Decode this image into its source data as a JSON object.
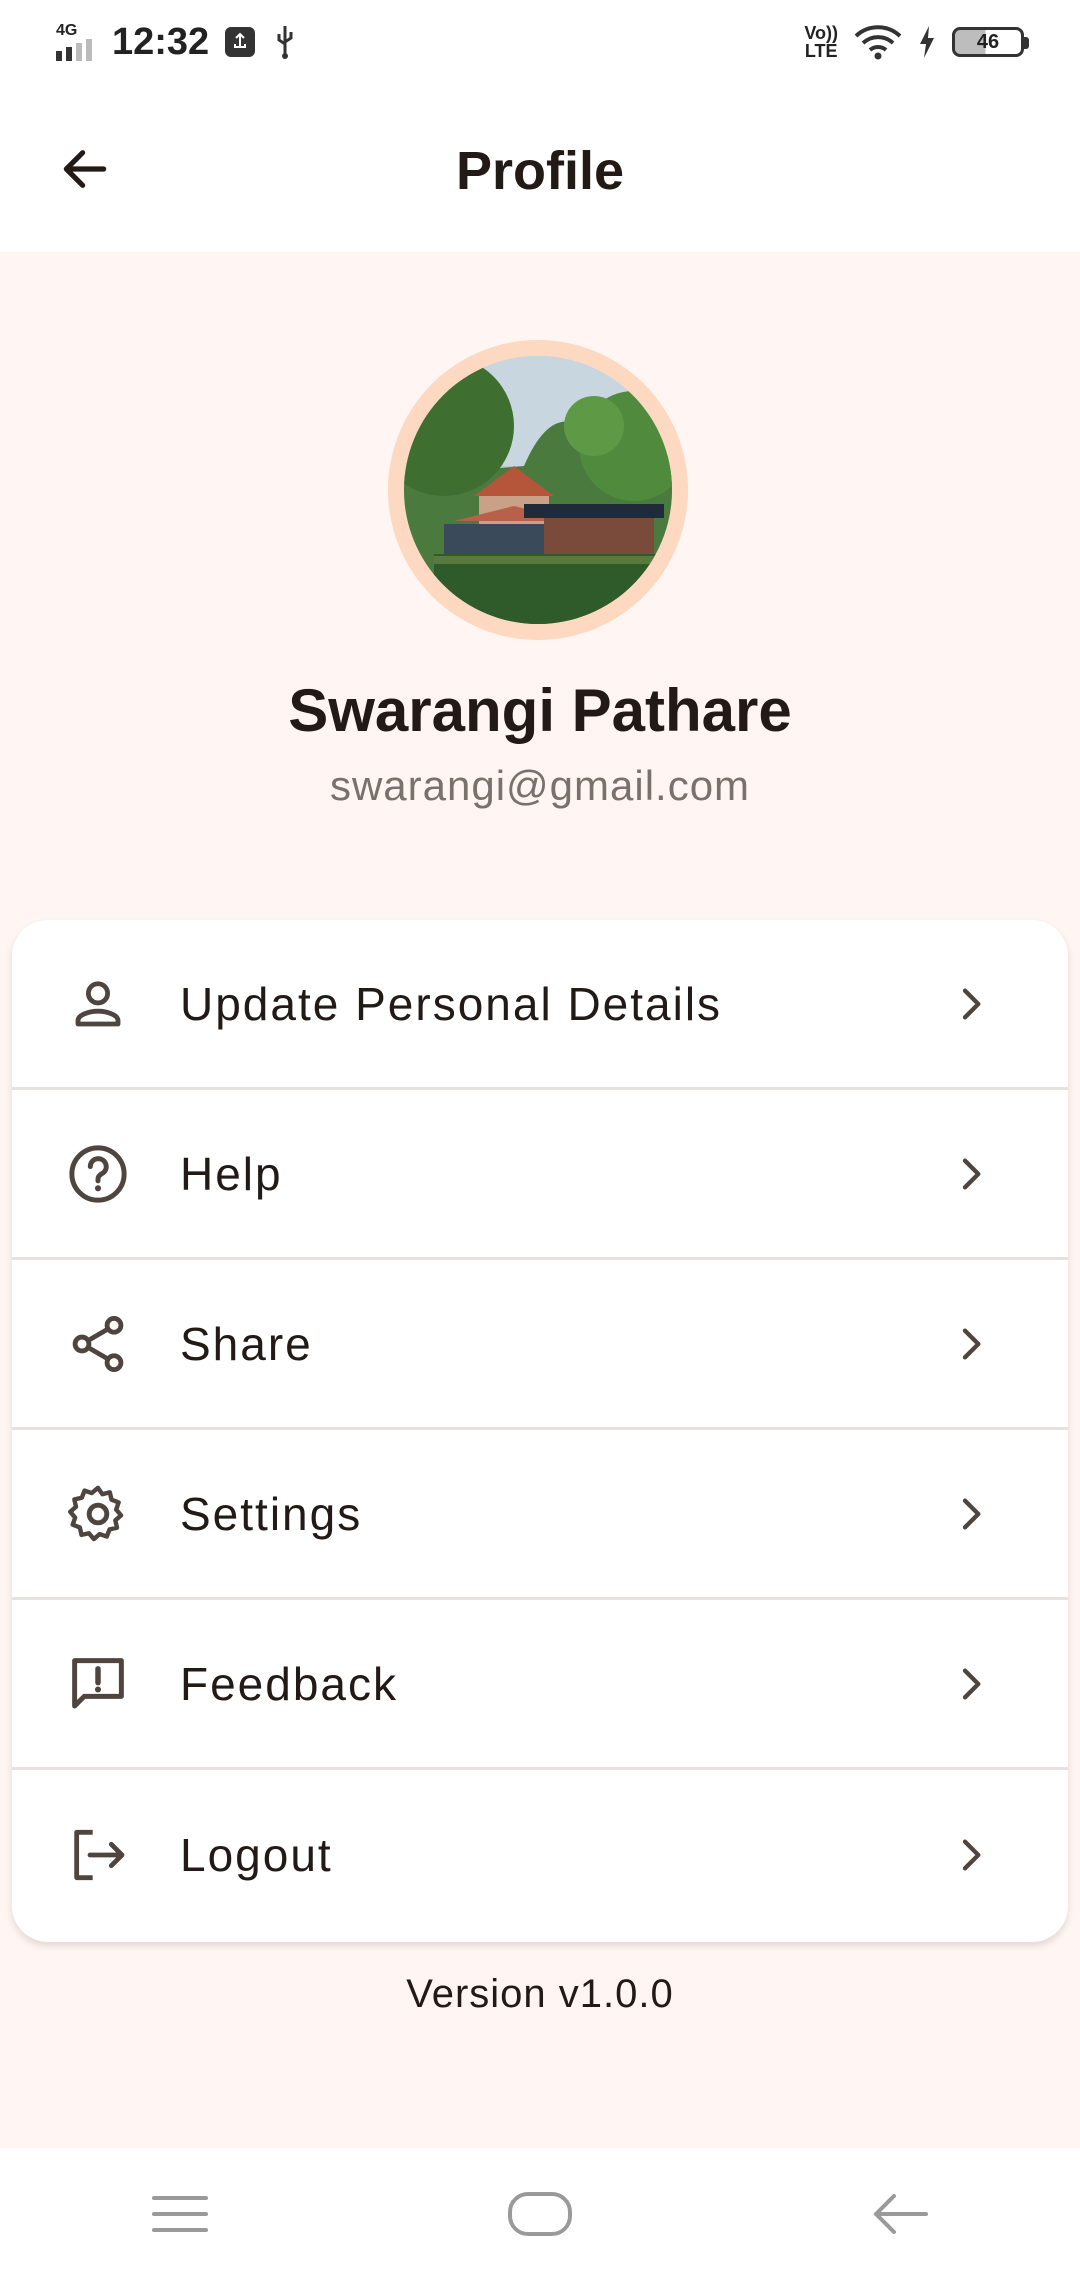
{
  "status_bar": {
    "network": "4G",
    "time": "12:32",
    "volte_top": "Vo))",
    "volte_bottom": "LTE",
    "battery": "46"
  },
  "app_bar": {
    "title": "Profile",
    "back_icon": "arrow-back-icon"
  },
  "profile": {
    "name": "Swarangi Pathare",
    "email": "swarangi@gmail.com",
    "avatar_ring_color": "#fcd9c0"
  },
  "menu": [
    {
      "label": "Update Personal Details",
      "icon": "person-icon"
    },
    {
      "label": "Help",
      "icon": "help-circle-icon"
    },
    {
      "label": "Share",
      "icon": "share-icon"
    },
    {
      "label": "Settings",
      "icon": "gear-icon"
    },
    {
      "label": "Feedback",
      "icon": "feedback-icon"
    },
    {
      "label": "Logout",
      "icon": "logout-icon"
    }
  ],
  "version": "Version v1.0.0",
  "colors": {
    "background": "#fff6f3",
    "icon": "#4f4540",
    "text": "#211a17"
  }
}
